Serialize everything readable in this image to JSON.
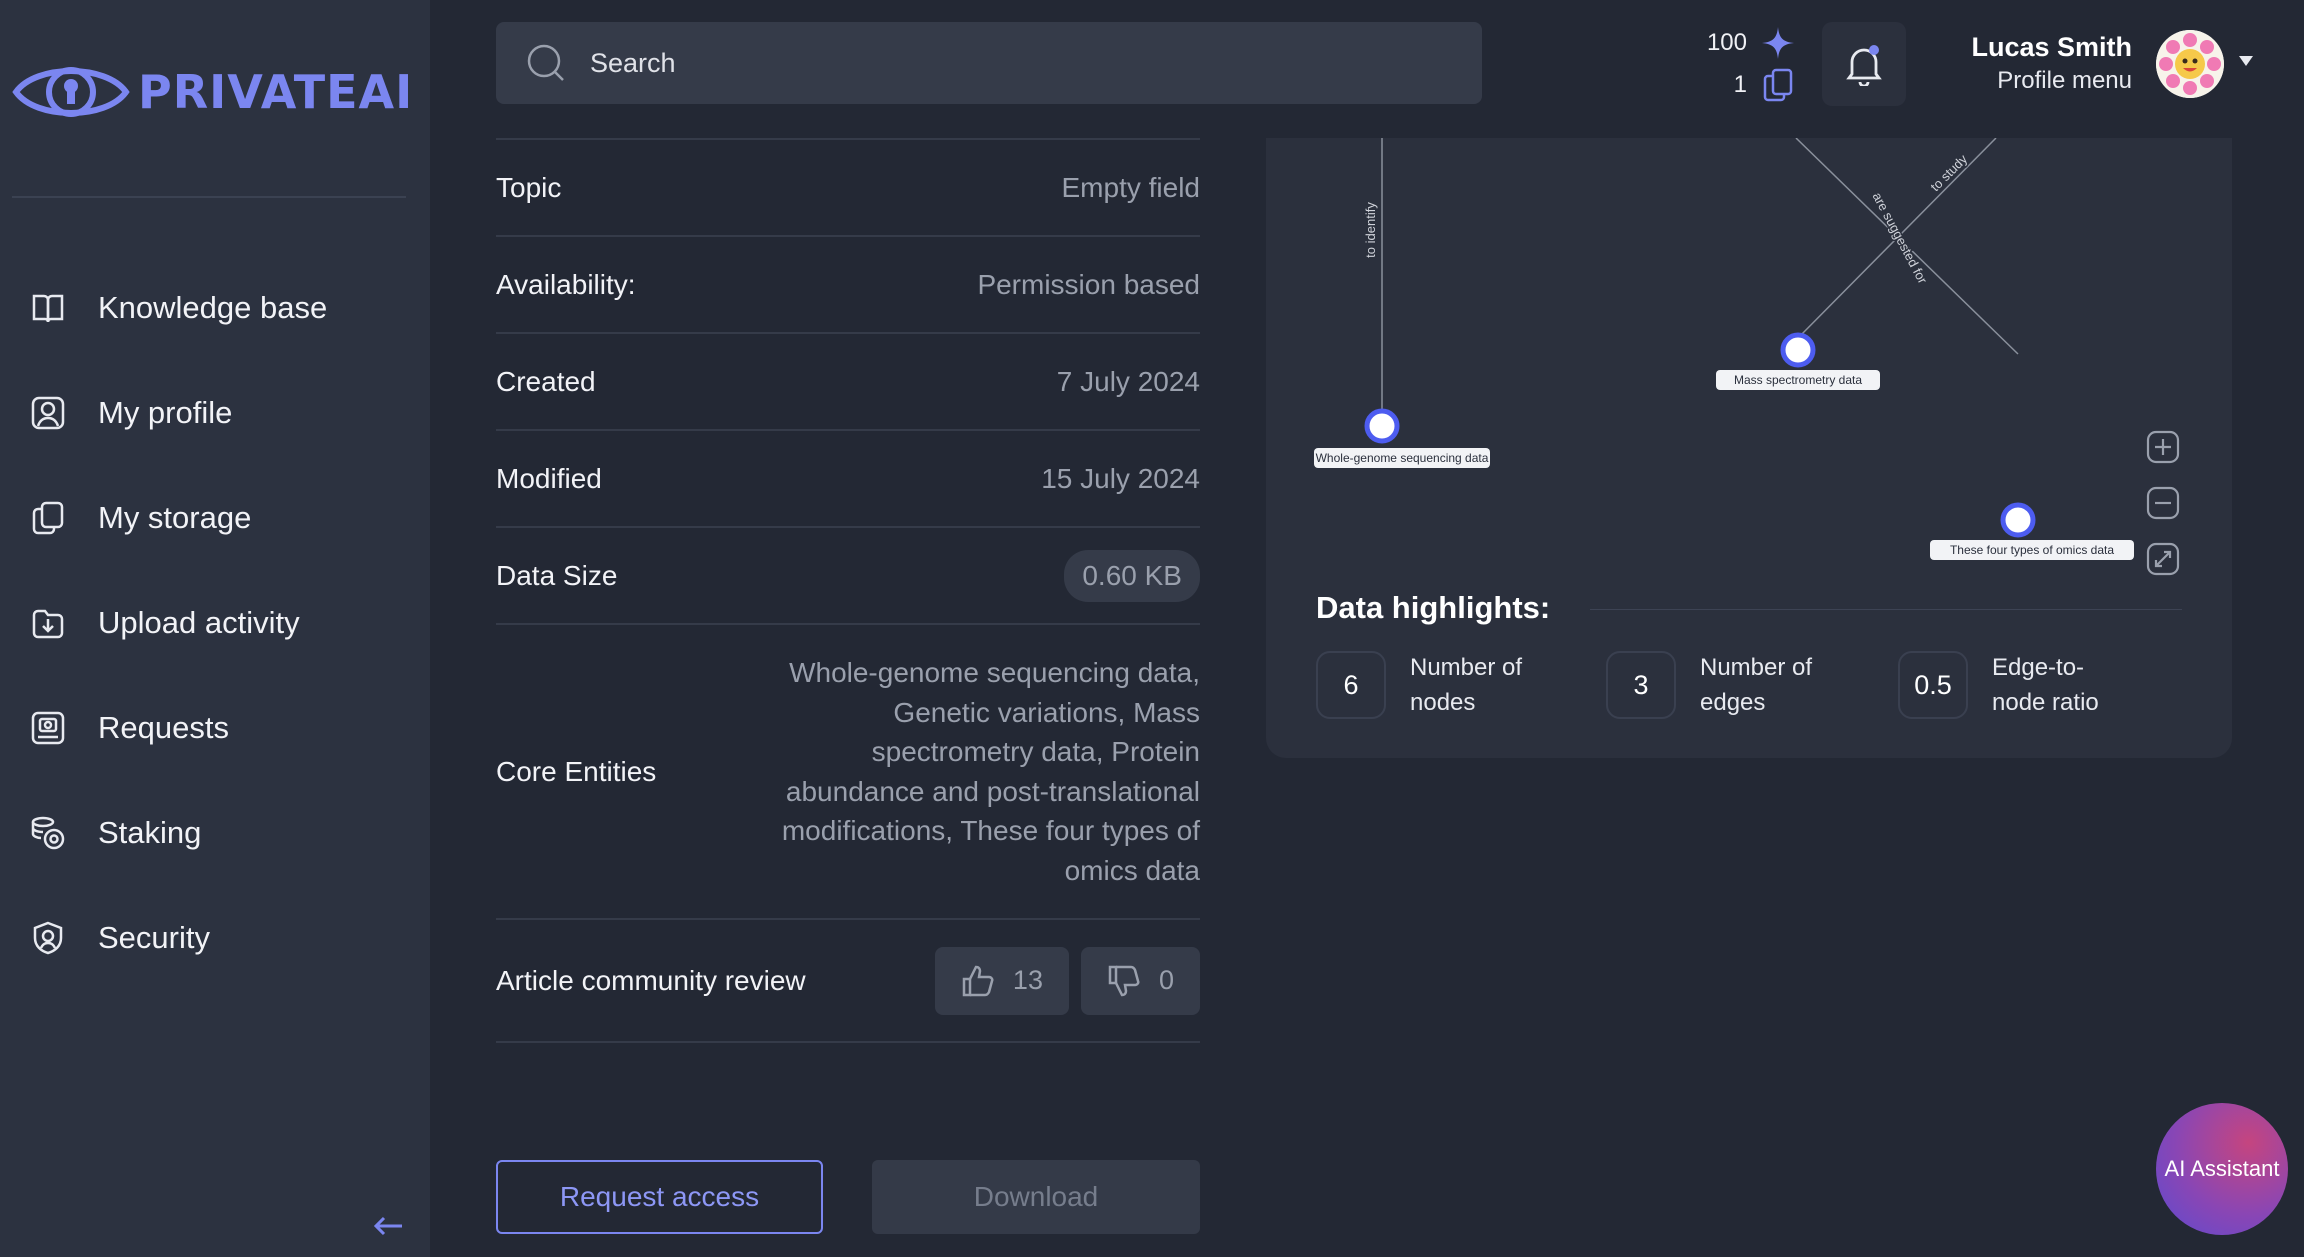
{
  "brand": {
    "name": "PRIVATEAI",
    "color": "#7b86f0"
  },
  "sidebar": {
    "items": [
      {
        "label": "Knowledge base",
        "icon": "book-icon"
      },
      {
        "label": "My profile",
        "icon": "user-icon"
      },
      {
        "label": "My storage",
        "icon": "copy-icon"
      },
      {
        "label": "Upload activity",
        "icon": "upload-icon"
      },
      {
        "label": "Requests",
        "icon": "request-icon"
      },
      {
        "label": "Staking",
        "icon": "coins-icon"
      },
      {
        "label": "Security",
        "icon": "shield-icon"
      }
    ],
    "collapse_icon": "arrow-left-icon"
  },
  "search": {
    "placeholder": "Search"
  },
  "credits": {
    "stars": "100",
    "documents": "1"
  },
  "user": {
    "name": "Lucas Smith",
    "subtitle": "Profile menu"
  },
  "details": {
    "topic": {
      "label": "Topic",
      "value": "Empty field"
    },
    "availability": {
      "label": "Availability:",
      "value": "Permission based"
    },
    "created": {
      "label": "Created",
      "value": "7 July 2024"
    },
    "modified": {
      "label": "Modified",
      "value": "15 July 2024"
    },
    "data_size": {
      "label": "Data Size",
      "value": "0.60 KB"
    },
    "core_entities": {
      "label": "Core Entities",
      "value": "Whole-genome sequencing data, Genetic variations, Mass spectrometry data, Protein abundance and post-translational modifications, These four types of omics data"
    },
    "review": {
      "label": "Article community review",
      "likes": "13",
      "dislikes": "0"
    }
  },
  "actions": {
    "request": "Request access",
    "download": "Download"
  },
  "graph": {
    "edge_labels": {
      "identify": "to identify",
      "study": "to study",
      "suggested": "are suggested for"
    },
    "nodes": {
      "genome": "Whole-genome sequencing data",
      "mass": "Mass spectrometry data",
      "omics": "These four types of omics data"
    },
    "accent": "#4d5cf0"
  },
  "highlights": {
    "title": "Data highlights:",
    "nodes": {
      "value": "6",
      "label": "Number of nodes"
    },
    "edges": {
      "value": "3",
      "label": "Number of edges"
    },
    "ratio": {
      "value": "0.5",
      "label": "Edge-to-node ratio"
    }
  },
  "assistant": {
    "label": "AI Assistant"
  }
}
